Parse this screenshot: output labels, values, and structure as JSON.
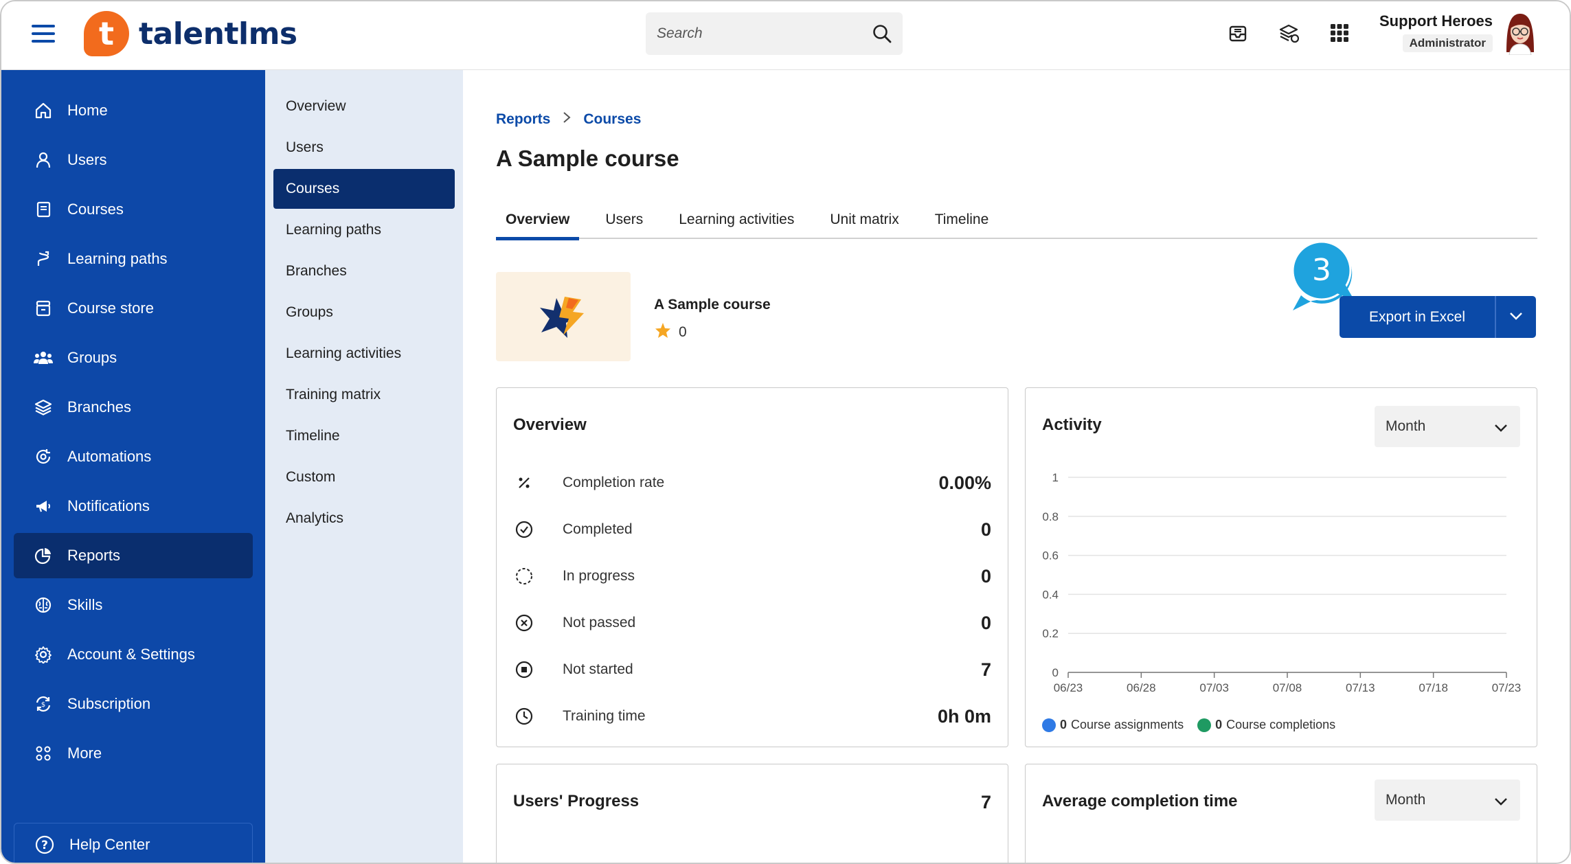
{
  "header": {
    "logo_text": "talentlms",
    "logo_letter": "t",
    "search_placeholder": "Search",
    "user_name": "Support Heroes",
    "user_role": "Administrator"
  },
  "sidebar": {
    "items": [
      {
        "label": "Home",
        "icon": "home-icon"
      },
      {
        "label": "Users",
        "icon": "user-icon"
      },
      {
        "label": "Courses",
        "icon": "book-icon"
      },
      {
        "label": "Learning paths",
        "icon": "path-icon"
      },
      {
        "label": "Course store",
        "icon": "store-icon"
      },
      {
        "label": "Groups",
        "icon": "groups-icon"
      },
      {
        "label": "Branches",
        "icon": "layers-icon"
      },
      {
        "label": "Automations",
        "icon": "automation-icon"
      },
      {
        "label": "Notifications",
        "icon": "megaphone-icon"
      },
      {
        "label": "Reports",
        "icon": "pie-chart-icon",
        "active": true
      },
      {
        "label": "Skills",
        "icon": "brain-icon"
      },
      {
        "label": "Account & Settings",
        "icon": "gear-icon"
      },
      {
        "label": "Subscription",
        "icon": "subscription-icon"
      },
      {
        "label": "More",
        "icon": "more-icon"
      }
    ],
    "help_center": "Help Center"
  },
  "submenu": {
    "items": [
      "Overview",
      "Users",
      "Courses",
      "Learning paths",
      "Branches",
      "Groups",
      "Learning activities",
      "Training matrix",
      "Timeline",
      "Custom",
      "Analytics"
    ],
    "active": "Courses"
  },
  "breadcrumb": {
    "root": "Reports",
    "current": "Courses"
  },
  "page_title": "A Sample course",
  "tabs": [
    "Overview",
    "Users",
    "Learning activities",
    "Unit matrix",
    "Timeline"
  ],
  "course": {
    "name": "A Sample course",
    "rating": "0"
  },
  "export": {
    "label": "Export in Excel"
  },
  "step_marker": "3",
  "overview": {
    "title": "Overview",
    "stats": [
      {
        "label": "Completion rate",
        "value": "0.00%",
        "icon": "percent-icon"
      },
      {
        "label": "Completed",
        "value": "0",
        "icon": "check-circle-icon"
      },
      {
        "label": "In progress",
        "value": "0",
        "icon": "dashed-circle-icon"
      },
      {
        "label": "Not passed",
        "value": "0",
        "icon": "x-circle-icon"
      },
      {
        "label": "Not started",
        "value": "7",
        "icon": "stop-circle-icon"
      },
      {
        "label": "Training time",
        "value": "0h 0m",
        "icon": "clock-icon"
      }
    ]
  },
  "activity": {
    "title": "Activity",
    "period": "Month",
    "legend": [
      {
        "count": "0",
        "label": "Course assignments",
        "color": "#2f7ae5"
      },
      {
        "count": "0",
        "label": "Course completions",
        "color": "#1f9a62"
      }
    ]
  },
  "chart_data": {
    "type": "line",
    "x": [
      "06/23",
      "06/28",
      "07/03",
      "07/08",
      "07/13",
      "07/18",
      "07/23"
    ],
    "ylim": [
      0,
      1
    ],
    "yticks": [
      "0",
      "0.2",
      "0.4",
      "0.6",
      "0.8",
      "1"
    ],
    "series": [
      {
        "name": "Course assignments",
        "values": [
          0,
          0,
          0,
          0,
          0,
          0,
          0
        ]
      },
      {
        "name": "Course completions",
        "values": [
          0,
          0,
          0,
          0,
          0,
          0,
          0
        ]
      }
    ],
    "grid": true,
    "legend": "bottom-left"
  },
  "users_progress": {
    "title": "Users' Progress",
    "value": "7"
  },
  "avg_completion": {
    "title": "Average completion time",
    "period": "Month"
  },
  "colors": {
    "primary": "#0b4aa8",
    "sidebar": "#0d48a8",
    "active": "#0a2e6e",
    "accent": "#f26b1d",
    "marker": "#1fa3de"
  }
}
